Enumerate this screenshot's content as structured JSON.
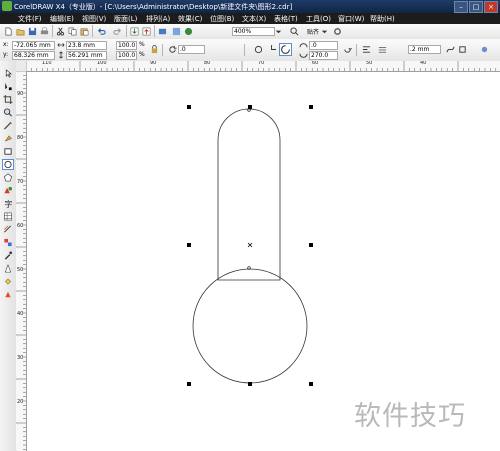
{
  "window": {
    "title": "CorelDRAW X4（专业版）- [C:\\Users\\Administrator\\Desktop\\新建文件夹\\图形2.cdr]"
  },
  "menu": [
    "文件(F)",
    "编辑(E)",
    "视图(V)",
    "版面(L)",
    "排列(A)",
    "效果(C)",
    "位图(B)",
    "文本(X)",
    "表格(T)",
    "工具(O)",
    "窗口(W)",
    "帮助(H)"
  ],
  "toolbar": {
    "zoom": "400%",
    "snap_label": "贴齐"
  },
  "property_bar": {
    "x": "-72.065 mm",
    "y": "68.326 mm",
    "width": "23.8 mm",
    "height": "56.291 mm",
    "scale_x": "100.0",
    "scale_y": "100.0",
    "percent": "%",
    "rotation": ".0",
    "start_angle": ".0",
    "end_angle": "270.0",
    "outline_width": ".2 mm"
  },
  "rulers": {
    "h_labels": [
      "110",
      "100",
      "90",
      "80",
      "70",
      "60",
      "50",
      "40"
    ],
    "v_labels": [
      "90",
      "80",
      "70",
      "60",
      "50",
      "40",
      "30",
      "20"
    ]
  },
  "watermark": "软件技巧"
}
